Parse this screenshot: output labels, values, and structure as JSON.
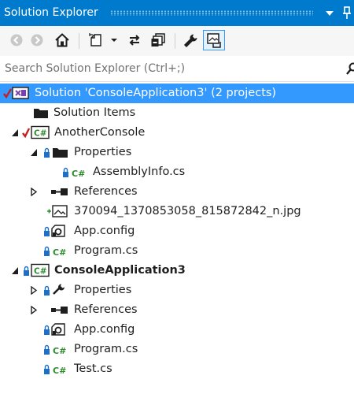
{
  "panel": {
    "title": "Solution Explorer"
  },
  "search": {
    "placeholder": "Search Solution Explorer (Ctrl+;)"
  },
  "toolbar": {
    "buttons": [
      "back-icon",
      "forward-icon",
      "home-icon",
      "pending-changes-icon",
      "sync-icon",
      "collapse-all-icon",
      "properties-icon",
      "preview-icon"
    ]
  },
  "tree": {
    "solution": "Solution 'ConsoleApplication3' (2 projects)",
    "solution_items": "Solution Items",
    "project1": "AnotherConsole",
    "properties1": "Properties",
    "assemblyinfo": "AssemblyInfo.cs",
    "references1": "References",
    "image_file": "370094_1370853058_815872842_n.jpg",
    "appconfig1": "App.config",
    "program1": "Program.cs",
    "project2": "ConsoleApplication3",
    "properties2": "Properties",
    "references2": "References",
    "appconfig2": "App.config",
    "program2": "Program.cs",
    "test": "Test.cs"
  },
  "colors": {
    "accent": "#007acc",
    "selection": "#3399ff",
    "check_red": "#c81e1e",
    "lock_blue": "#1e6fc8",
    "csharp_green": "#2e8b2e"
  }
}
